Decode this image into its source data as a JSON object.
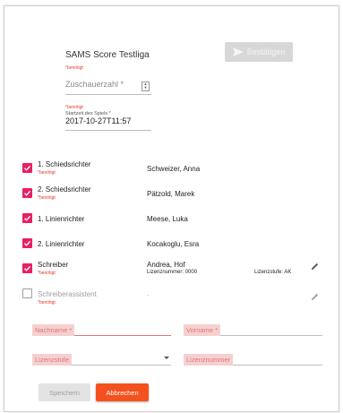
{
  "header": {
    "title": "SAMS Score Testliga",
    "required": "*benötigt",
    "confirm_label": "Bestätigen",
    "spectators_placeholder": "Zuschauerzahl *",
    "start_required": "*benötigt",
    "start_label": "Startzeit des Spiels *",
    "start_value": "2017-10-27T11:57"
  },
  "officials": [
    {
      "role": "1. Schiedsrichter",
      "required": "*benötigt",
      "name": "Schweizer, Anna"
    },
    {
      "role": "2. Schiedsrichter",
      "required": "*benötigt",
      "name": "Pätzold, Marek"
    },
    {
      "role": "1. Linienrichter",
      "required": "",
      "name": "Meese, Luka"
    },
    {
      "role": "2. Linienrichter",
      "required": "",
      "name": "Kocakoglu, Esra"
    },
    {
      "role": "Schreiber",
      "required": "*benötigt",
      "name": "Andrea, Hof",
      "license_number": "Lizenznummer: 0000",
      "license_level": "Lizenzstufe: AK"
    },
    {
      "role": "Schreiberassistent",
      "required": "*benötigt",
      "name": "-"
    }
  ],
  "form": {
    "lastname_placeholder": "Nachname *",
    "firstname_placeholder": "Vorname *",
    "license_level_placeholder": "Lizenzstufe",
    "license_number_placeholder": "Lizenznummer",
    "save_label": "Speichern",
    "cancel_label": "Abbrechen"
  },
  "colors": {
    "accent": "#e91e63",
    "cancel": "#f4511e"
  }
}
